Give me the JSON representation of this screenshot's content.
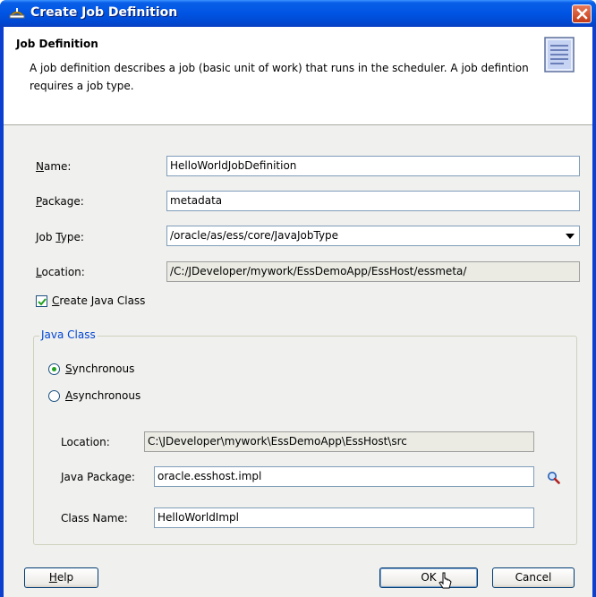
{
  "window": {
    "title": "Create Job Definition"
  },
  "header": {
    "title": "Job Definition",
    "description": "A job definition describes a job (basic unit of work) that runs in the scheduler.  A job defintion requires a job type."
  },
  "form": {
    "name": {
      "label_mn": "N",
      "label_rest": "ame:",
      "value": "HelloWorldJobDefinition"
    },
    "package": {
      "label_mn": "P",
      "label_rest": "ackage:",
      "value": "metadata"
    },
    "job_type": {
      "label_pre": "Job ",
      "label_mn": "T",
      "label_rest": "ype:",
      "value": "/oracle/as/ess/core/JavaJobType"
    },
    "location": {
      "label_mn": "L",
      "label_rest": "ocation:",
      "value": "/C:/JDeveloper/mywork/EssDemoApp/EssHost/essmeta/"
    },
    "create_java_class": {
      "label_mn": "C",
      "label_rest": "reate Java Class",
      "checked": true
    }
  },
  "java_class": {
    "legend": "Java Class",
    "synchronous": {
      "label_mn": "S",
      "label_rest": "ynchronous",
      "selected": true
    },
    "asynchronous": {
      "label_mn": "A",
      "label_rest": "synchronous",
      "selected": false
    },
    "location": {
      "label": "Location:",
      "value": "C:\\JDeveloper\\mywork\\EssDemoApp\\EssHost\\src"
    },
    "java_package": {
      "label": "Java Package:",
      "value": "oracle.esshost.impl"
    },
    "class_name": {
      "label": "Class Name:",
      "value": "HelloWorldImpl"
    }
  },
  "buttons": {
    "help": {
      "label_mn": "H",
      "label_rest": "elp"
    },
    "ok": "OK",
    "cancel": "Cancel"
  },
  "icons": {
    "title": "create-job-icon",
    "close": "close-icon",
    "header": "document-icon",
    "search": "search-icon"
  },
  "colors": {
    "titlebar": "#0054e3",
    "close": "#c43a18",
    "legend": "#0046d5",
    "radio_dot": "#21a121"
  }
}
